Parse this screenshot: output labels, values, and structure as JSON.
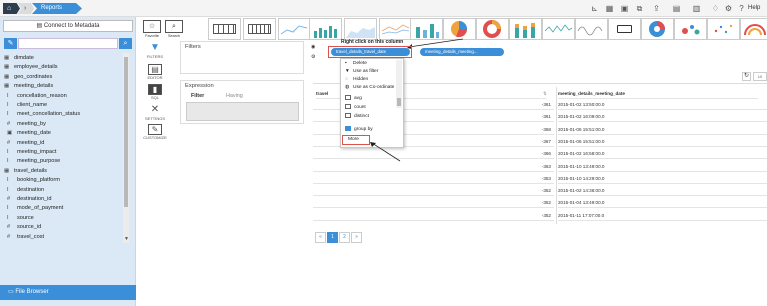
{
  "topbar": {
    "home_icon": "home-icon",
    "breadcrumb_next": "›",
    "breadcrumb_reports": "Reports",
    "help_label": "Help",
    "icons": [
      "chart-icon",
      "grid-icon",
      "save-icon",
      "copy-icon",
      "share-icon",
      "layout-icon",
      "export-icon",
      "bell-icon",
      "gear-icon",
      "help-icon"
    ]
  },
  "sidebar": {
    "connect_label": "Connect to Metadata",
    "tree_items": [
      {
        "icon": "table-icon",
        "label": "dimdate"
      },
      {
        "icon": "table-icon",
        "label": "employee_details"
      },
      {
        "icon": "table-icon",
        "label": "geo_cordinates"
      },
      {
        "icon": "table-icon",
        "label": "meeting_details"
      },
      {
        "icon": "text-field-icon",
        "label": "concellation_reason"
      },
      {
        "icon": "text-field-icon",
        "label": "client_name"
      },
      {
        "icon": "text-field-icon",
        "label": "meet_concellation_status"
      },
      {
        "icon": "key-field-icon",
        "label": "meeting_by"
      },
      {
        "icon": "date-field-icon",
        "label": "meeting_date"
      },
      {
        "icon": "key-field-icon",
        "label": "meeting_id"
      },
      {
        "icon": "text-field-icon",
        "label": "meeting_impact"
      },
      {
        "icon": "text-field-icon",
        "label": "meeting_purpose"
      },
      {
        "icon": "table-icon",
        "label": "travel_details"
      },
      {
        "icon": "text-field-icon",
        "label": "booking_platform"
      },
      {
        "icon": "text-field-icon",
        "label": "destination"
      },
      {
        "icon": "key-field-icon",
        "label": "destination_id"
      },
      {
        "icon": "text-field-icon",
        "label": "mode_of_payment"
      },
      {
        "icon": "text-field-icon",
        "label": "source"
      },
      {
        "icon": "key-field-icon",
        "label": "source_id"
      },
      {
        "icon": "key-field-icon",
        "label": "travel_cost"
      }
    ],
    "file_browser_label": "File Browser"
  },
  "vbar": [
    {
      "icon": "filter-icon",
      "label": "FILTERS"
    },
    {
      "icon": "editor-icon",
      "label": "EDITOR"
    },
    {
      "icon": "sql-icon",
      "label": "SQL"
    },
    {
      "icon": "settings-icon",
      "label": "SETTINGS"
    },
    {
      "icon": "customize-icon",
      "label": "CUSTOMIZE"
    }
  ],
  "top_actions": {
    "favorite": "Favorite",
    "search": "Search"
  },
  "filters": {
    "title": "Filters"
  },
  "expression": {
    "title": "Expression",
    "tab_filter": "Filter",
    "tab_having": "Having"
  },
  "fields": {
    "callout": "Right click on this column",
    "pill_1": "travel_details_travel_date",
    "pill_2": "meeting_details_meeting..."
  },
  "context_menu": {
    "items": [
      {
        "label": "Delete",
        "icon": "trash-icon"
      },
      {
        "label": "Use as filter",
        "icon": "filter-icon"
      },
      {
        "label": "Hidden",
        "icon": "eye-slash-icon"
      },
      {
        "label": "Use as Co-ordinate",
        "icon": "globe-icon"
      }
    ],
    "aggregates": [
      {
        "label": "avg",
        "checked": false
      },
      {
        "label": "count",
        "checked": false
      },
      {
        "label": "distinct",
        "checked": false
      },
      {
        "label": "group by",
        "checked": true
      }
    ],
    "more_label": "More"
  },
  "table": {
    "col1_header": "travel",
    "col2_header": "meeting_details_meeting_date",
    "rows": [
      {
        "id": "-361",
        "date": "2015-01-02 13:50:00.0"
      },
      {
        "id": "-361",
        "date": "2015-01-02 16:09:00.0"
      },
      {
        "id": "-368",
        "date": "2015-01-06 15:51:00.0"
      },
      {
        "id": "-367",
        "date": "2015-01-06 15:51:00.0"
      },
      {
        "id": "-366",
        "date": "2015-01-02 16:58:00.0"
      },
      {
        "id": "-363",
        "date": "2015-01-10 13:49:00.0"
      },
      {
        "id": "-353",
        "date": "2015-01-10 14:29:00.0"
      },
      {
        "id": "-352",
        "date": "2015-01-02 14:36:00.0"
      },
      {
        "id": "-352",
        "date": "2015-01-04 13:49:00.0"
      },
      {
        "id": "-352",
        "date": "2015-01-11 17:07:00.0"
      }
    ]
  },
  "pager": {
    "prev": "«",
    "page1": "1",
    "page2": "2",
    "next": "»"
  },
  "colors": {
    "accent": "#3b8fd9",
    "highlight": "#d9534f",
    "dark": "#2d3e50"
  }
}
